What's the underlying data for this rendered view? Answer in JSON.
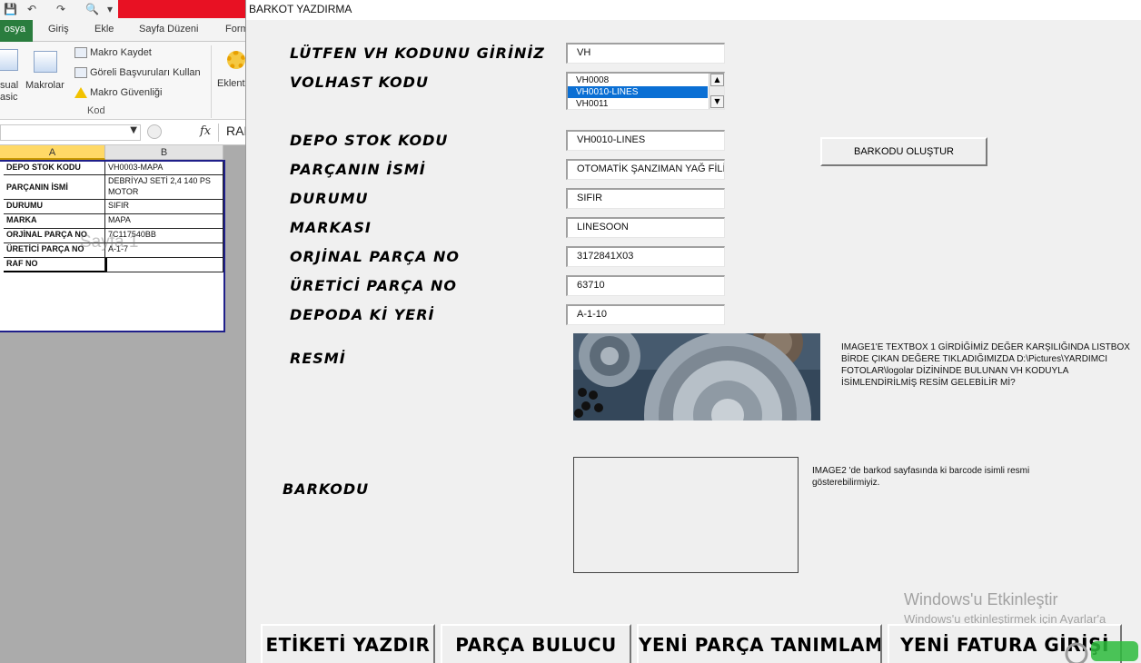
{
  "excel": {
    "ribbon_tabs": [
      "osya",
      "Giriş",
      "Ekle",
      "Sayfa Düzeni",
      "Form"
    ],
    "ribbon": {
      "visual_basic_label": [
        "sual",
        "asic"
      ],
      "makrolar_label": "Makrolar",
      "makro_kaydet": "Makro Kaydet",
      "goreli": "Göreli Başvuruları Kullan",
      "makro_guvenligi": "Makro Güvenliği",
      "group_kod": "Kod",
      "eklenti": "Eklent"
    },
    "formula_bar": {
      "fx": "fx",
      "value": "RAF"
    },
    "columns": [
      "A",
      "B"
    ],
    "rows": [
      {
        "label": "DEPO STOK KODU",
        "value": "VH0003-MAPA"
      },
      {
        "label": "PARÇANIN İSMİ",
        "value": "DEBRİYAJ SETİ 2,4 140 PS MOTOR"
      },
      {
        "label": "DURUMU",
        "value": "SIFIR"
      },
      {
        "label": "MARKA",
        "value": "MAPA"
      },
      {
        "label": "ORJİNAL PARÇA NO",
        "value": "7C117540BB"
      },
      {
        "label": "ÜRETİCİ PARÇA NO",
        "value": "A-1-7"
      },
      {
        "label": "RAF NO",
        "value": ""
      }
    ],
    "sheet_watermark": "Sayfa 1"
  },
  "form": {
    "title": "BARKOT YAZDIRMA",
    "vh_label": "LÜTFEN VH KODUNU GİRİNİZ",
    "vh_value": "VH",
    "volhast_label": "VOLHAST KODU",
    "list_items": [
      "VH0008",
      "VH0010-LINES",
      "VH0011"
    ],
    "fields": [
      {
        "label": "DEPO STOK KODU",
        "value": "VH0010-LINES"
      },
      {
        "label": "PARÇANIN İSMİ",
        "value": "OTOMATİK ŞANZIMAN YAĞ FİLİTR"
      },
      {
        "label": "DURUMU",
        "value": "SIFIR"
      },
      {
        "label": "MARKASI",
        "value": "LINESOON"
      },
      {
        "label": "ORJİNAL PARÇA NO",
        "value": "3172841X03"
      },
      {
        "label": "ÜRETİCİ PARÇA NO",
        "value": "63710"
      },
      {
        "label": "DEPODA Kİ YERİ",
        "value": "A-1-10"
      }
    ],
    "create_button": "BARKODU OLUŞTUR",
    "resmi_label": "RESMİ",
    "image1_note": [
      "IMAGE1'E TEXTBOX 1 GİRDİĞİMİZ DEĞER KARŞILIĞINDA LISTBOX",
      "BİRDE ÇIKAN DEĞERE TIKLADIĞIMIZDA D:\\Pictures\\YARDIMCI",
      "FOTOLAR\\logolar DİZİNİNDE BULUNAN VH KODUYLA",
      "İSİMLENDİRİLMİŞ RESİM GELEBİLİR Mİ?"
    ],
    "barkodu_label": "BARKODU",
    "image2_note": [
      "IMAGE2 'de barkod sayfasında ki barcode isimli resmi",
      "gösterebilirmiyiz."
    ],
    "buttons": [
      "ETİKETİ YAZDIR",
      "PARÇA BULUCU",
      "YENİ PARÇA TANIMLAMA",
      "YENİ FATURA GİRİŞİ"
    ]
  },
  "activation": {
    "title": "Windows'u Etkinleştir",
    "subtitle": "Windows'u etkinleştirmek için Ayarlar'a"
  },
  "colors": {
    "excel_green": "#2a7d3e",
    "selection_blue": "#0a6fd4",
    "title_red": "#e81123"
  }
}
